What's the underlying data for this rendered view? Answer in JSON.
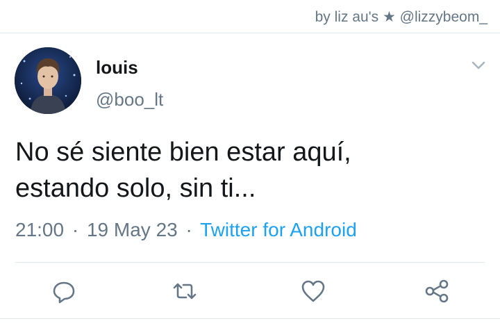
{
  "credit": "by liz au's ★ @lizzybeom_",
  "tweet": {
    "display_name": "louis",
    "handle": "@boo_lt",
    "text_lines": [
      "No sé siente bien estar aquí,",
      "estando solo, sin ti..."
    ],
    "time": "21:00",
    "separator": "·",
    "date": "19 May 23",
    "source": "Twitter for Android"
  },
  "icons": {
    "menu": "chevron-down-icon",
    "reply": "reply-icon",
    "retweet": "retweet-icon",
    "like": "heart-icon",
    "share": "share-icon"
  },
  "colors": {
    "text": "#14171a",
    "secondary": "#657786",
    "link": "#1da1f2",
    "divider": "#e1e8ed"
  }
}
